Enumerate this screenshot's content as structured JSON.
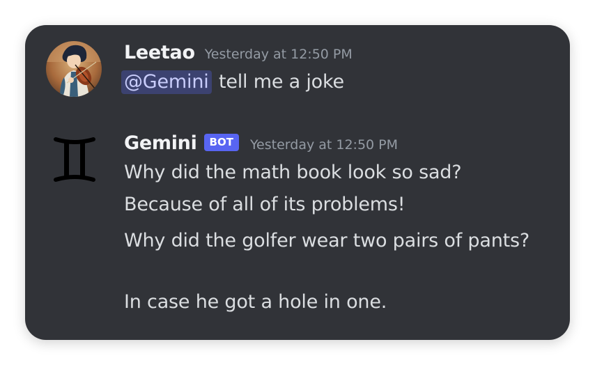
{
  "messages": [
    {
      "author": "Leetao",
      "timestamp": "Yesterday at 12:50 PM",
      "mention": "@Gemini",
      "text": "tell me a joke",
      "avatar_icon": "user-avatar-violinist"
    },
    {
      "author": "Gemini",
      "bot_tag": "BOT",
      "timestamp": "Yesterday at 12:50 PM",
      "avatar_icon": "gemini-zodiac-icon",
      "lines": [
        "Why did the math book look so sad?",
        "Because of all of its problems!",
        "Why did the golfer wear two pairs of pants?",
        "In case he got a hole in one."
      ]
    }
  ],
  "colors": {
    "background": "#313338",
    "username": "#f2f3f5",
    "timestamp": "#949ba4",
    "message_text": "#dbdee1",
    "mention_bg": "#3c4270",
    "mention_text": "#c9cdfb",
    "bot_tag_bg": "#5865f2"
  }
}
